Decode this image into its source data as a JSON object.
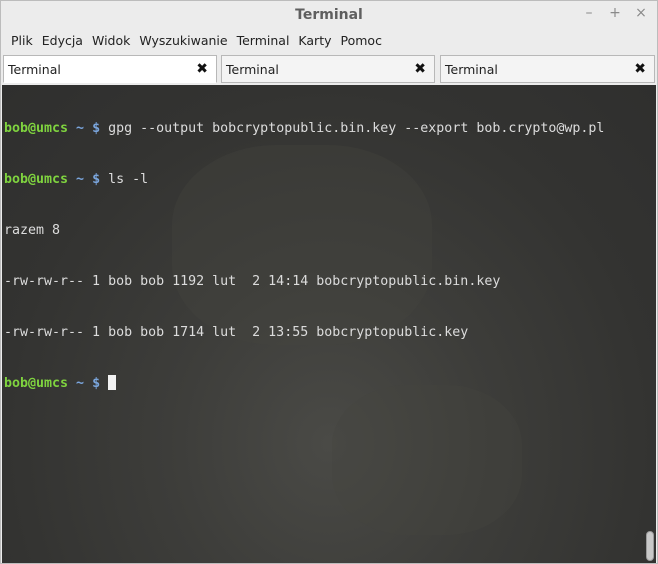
{
  "window": {
    "title": "Terminal",
    "controls": {
      "minimize": "–",
      "maximize": "+",
      "close": "×"
    }
  },
  "menubar": {
    "items": [
      "Plik",
      "Edycja",
      "Widok",
      "Wyszukiwanie",
      "Terminal",
      "Karty",
      "Pomoc"
    ]
  },
  "tabs": [
    {
      "label": "Terminal",
      "active": true,
      "close": "✖"
    },
    {
      "label": "Terminal",
      "active": false,
      "close": "✖"
    },
    {
      "label": "Terminal",
      "active": false,
      "close": "✖"
    }
  ],
  "terminal": {
    "prompt_user": "bob@umcs",
    "prompt_path": " ~ $",
    "lines": {
      "cmd1": " gpg --output bobcryptopublic.bin.key --export bob.crypto@wp.pl",
      "cmd2": " ls -l",
      "out1": "razem 8",
      "out2": "-rw-rw-r-- 1 bob bob 1192 lut  2 14:14 bobcryptopublic.bin.key",
      "out3": "-rw-rw-r-- 1 bob bob 1714 lut  2 13:55 bobcryptopublic.key",
      "cmd3": " "
    }
  },
  "colors": {
    "prompt_user": "#7fd33f",
    "prompt_path": "#7aa5dc",
    "terminal_text": "#dcdcdc",
    "terminal_bg": "#333331"
  },
  "icons": {
    "tab_close": "close-icon",
    "window_minimize": "minimize-icon",
    "window_maximize": "maximize-icon",
    "window_close": "close-icon"
  }
}
